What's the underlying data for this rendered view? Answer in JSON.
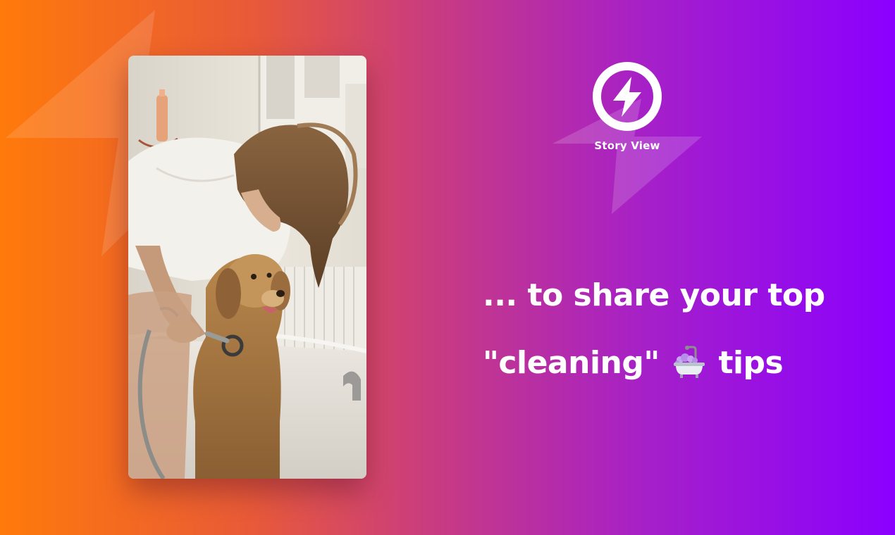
{
  "brand": {
    "logo_text": "Story View"
  },
  "headline": {
    "line1": "... to share your top",
    "line2_text": "\"cleaning\"",
    "line2_emoji": "bathtub-icon",
    "line2_end": "tips"
  },
  "story_card": {
    "image": "woman washing golden retriever in bathtub"
  },
  "colors": {
    "gradient_start": "#ff7a0a",
    "gradient_mid": "#c93c80",
    "gradient_end": "#8a00ff",
    "text": "#ffffff"
  }
}
